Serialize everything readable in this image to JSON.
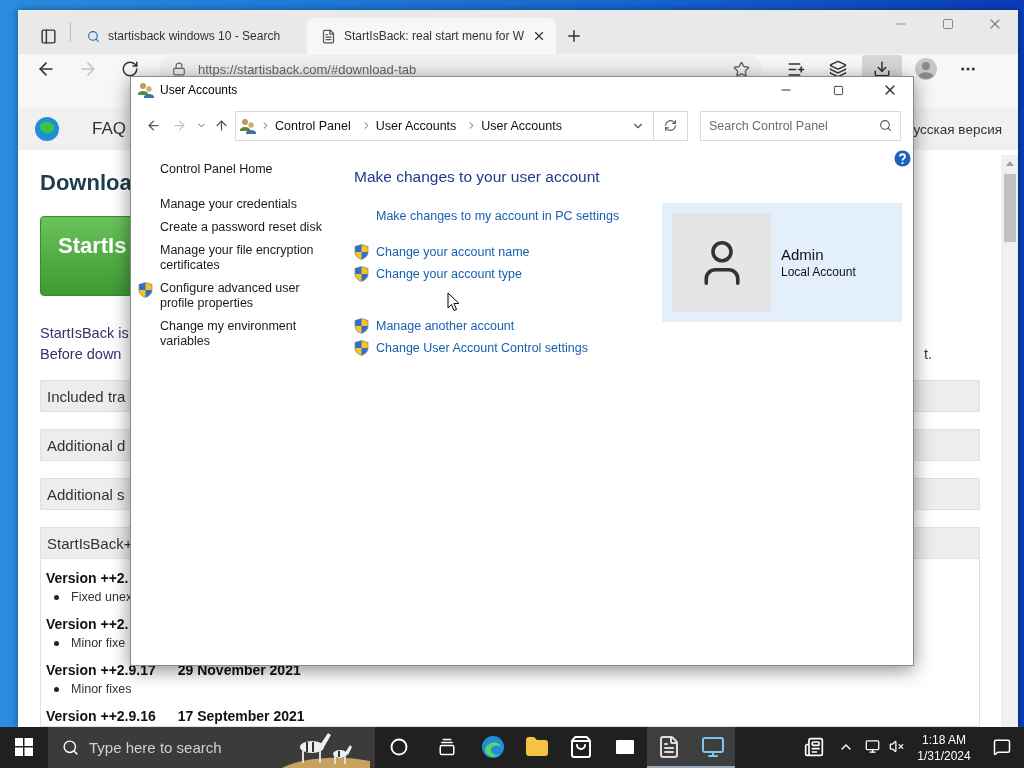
{
  "browser": {
    "tabs": [
      {
        "title": "startisback windows 10 - Search",
        "kind": "search",
        "selected": false
      },
      {
        "title": "StartIsBack: real start menu for W",
        "kind": "page",
        "selected": true
      }
    ],
    "address": "https://startisback.com/#download-tab",
    "forward_disabled": true,
    "downloads_active": true,
    "page": {
      "header_link": "FAQ",
      "language_link": "усская версия",
      "heading": "Downloa",
      "download_button": "StartIs",
      "intro_lines": [
        {
          "start": "StartIsBack is"
        },
        {
          "start": "Before down",
          "end": "t."
        }
      ],
      "sections": [
        "Included tra",
        "Additional d",
        "Additional s",
        "StartIsBack+"
      ],
      "versions": [
        {
          "version": "Version ++2.",
          "notes": [
            "Fixed unex"
          ]
        },
        {
          "version": "Version ++2.",
          "notes": [
            "Minor fixe"
          ]
        },
        {
          "version": "Version ++2.9.17",
          "date": "29 November 2021",
          "notes": [
            "Minor fixes"
          ]
        },
        {
          "version": "Version ++2.9.16",
          "date": "17 September 2021"
        }
      ]
    }
  },
  "dialog": {
    "title": "User Accounts",
    "forward_disabled": true,
    "breadcrumb": [
      "Control Panel",
      "User Accounts",
      "User Accounts"
    ],
    "search": {
      "placeholder": "Search Control Panel"
    },
    "sidebar": {
      "home": "Control Panel Home",
      "tasks": [
        {
          "label": "Manage your credentials",
          "shield": false
        },
        {
          "label": "Create a password reset disk",
          "shield": false
        },
        {
          "label": "Manage your file encryption certificates",
          "shield": false
        },
        {
          "label": "Configure advanced user profile properties",
          "shield": true
        },
        {
          "label": "Change my environment variables",
          "shield": false
        }
      ]
    },
    "heading": "Make changes to your user account",
    "link_groups": [
      {
        "links": [
          {
            "label": "Make changes to my account in PC settings",
            "shield": false
          }
        ]
      },
      {
        "links": [
          {
            "label": "Change your account name",
            "shield": true
          },
          {
            "label": "Change your account type",
            "shield": true
          }
        ]
      },
      {
        "links": [
          {
            "label": "Manage another account",
            "shield": true
          },
          {
            "label": "Change User Account Control settings",
            "shield": true
          }
        ]
      }
    ],
    "account": {
      "name": "Admin",
      "type": "Local Account"
    }
  },
  "taskbar": {
    "search": {
      "placeholder": "Type here to search"
    },
    "apps": [
      {
        "kind": "edge",
        "active": false
      },
      {
        "kind": "explorer",
        "active": false
      },
      {
        "kind": "store",
        "active": false
      },
      {
        "kind": "mail",
        "active": false
      },
      {
        "kind": "document",
        "active": true
      },
      {
        "kind": "control-panel",
        "active": true
      }
    ],
    "time": "1:18 AM",
    "date": "1/31/2024"
  }
}
